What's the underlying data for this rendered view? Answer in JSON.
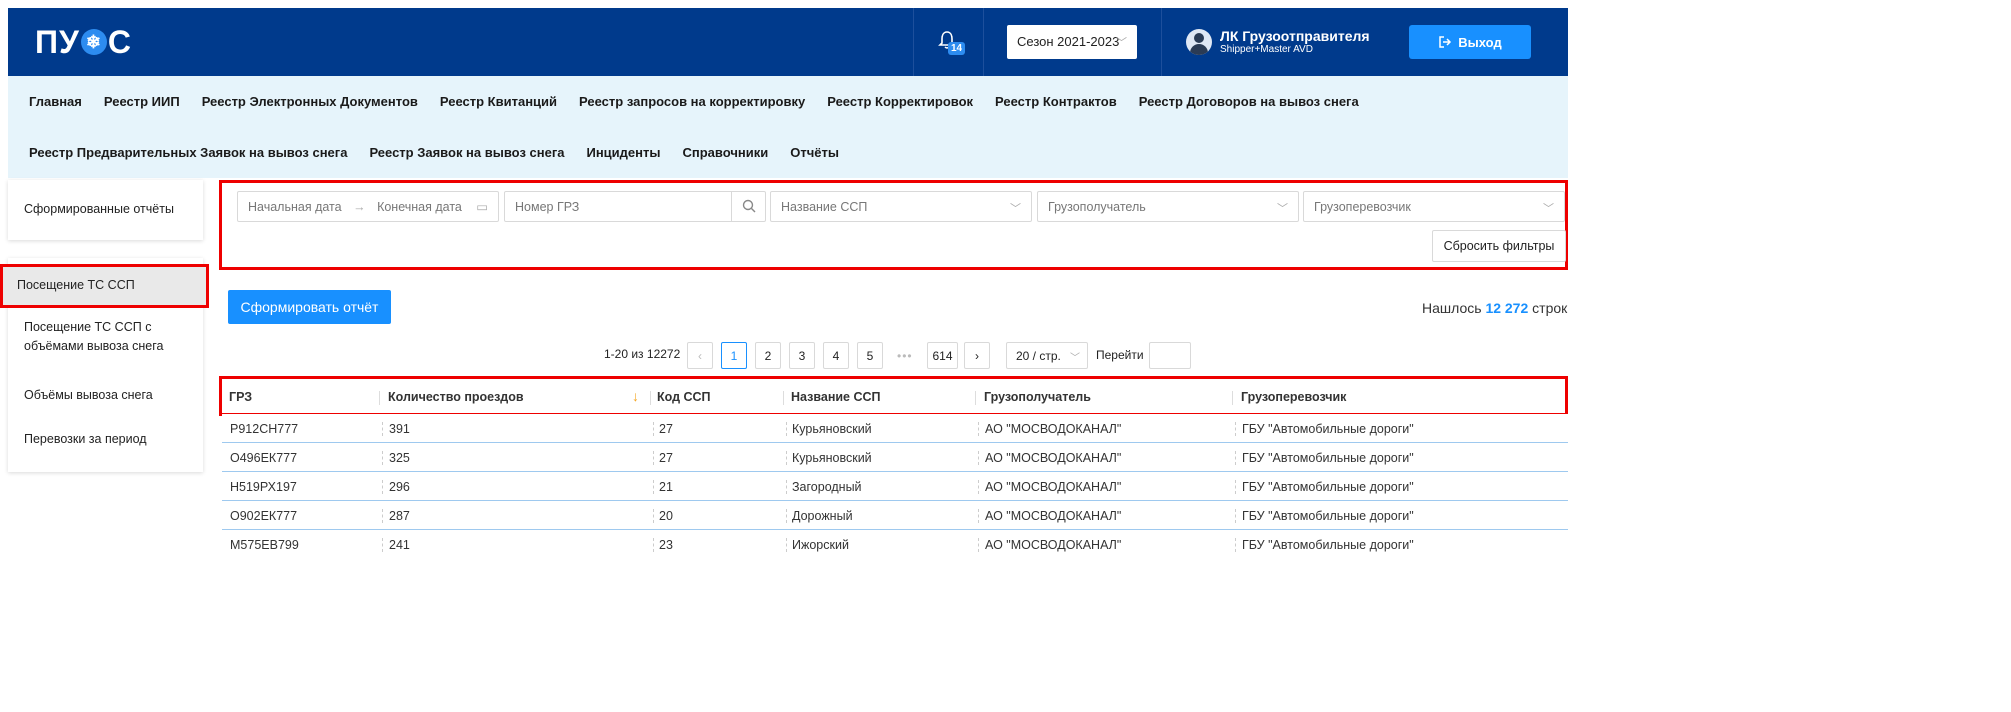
{
  "app": {
    "logo": "ПУ",
    "logo_end": "С"
  },
  "header": {
    "notifications_count": "14",
    "season": "Сезон 2021-2023",
    "user_title": "ЛК Грузоотправителя",
    "user_sub": "Shipper+Master AVD",
    "logout": "Выход"
  },
  "nav": {
    "row1": [
      "Главная",
      "Реестр ИИП",
      "Реестр Электронных Документов",
      "Реестр Квитанций",
      "Реестр запросов на корректировку",
      "Реестр Корректировок",
      "Реестр Контрактов",
      "Реестр Договоров на вывоз снега"
    ],
    "row2": [
      "Реестр Предварительных Заявок на вывоз снега",
      "Реестр Заявок на вывоз снега",
      "Инциденты",
      "Справочники",
      "Отчёты"
    ]
  },
  "sidebar": {
    "generated": "Сформированные отчёты",
    "items": [
      "Посещение ТС ССП",
      "Посещение ТС ССП с объёмами вывоза снега",
      "Объёмы вывоза снега",
      "Перевозки за период"
    ]
  },
  "filters": {
    "start_date": "Начальная дата",
    "end_date": "Конечная дата",
    "grz": "Номер ГРЗ",
    "ssp": "Название ССП",
    "consignee": "Грузополучатель",
    "carrier": "Грузоперевозчик",
    "reset": "Сбросить фильтры"
  },
  "actions": {
    "generate": "Сформировать отчёт"
  },
  "summary": {
    "found_prefix": "Нашлось",
    "found_count": "12 272",
    "found_suffix": "строк"
  },
  "pagination": {
    "range": "1-20 из 12272",
    "pages": [
      "1",
      "2",
      "3",
      "4",
      "5"
    ],
    "ellipsis": "•••",
    "last": "614",
    "page_size": "20 / стр.",
    "goto": "Перейти",
    "current": "1"
  },
  "table": {
    "columns": [
      "ГРЗ",
      "Количество проездов",
      "Код ССП",
      "Название ССП",
      "Грузополучатель",
      "Грузоперевозчик"
    ],
    "rows": [
      [
        "Р912СН777",
        "391",
        "27",
        "Курьяновский",
        "АО \"МОСВОДОКАНАЛ\"",
        "ГБУ \"Автомобильные дороги\""
      ],
      [
        "О496ЕК777",
        "325",
        "27",
        "Курьяновский",
        "АО \"МОСВОДОКАНАЛ\"",
        "ГБУ \"Автомобильные дороги\""
      ],
      [
        "Н519РХ197",
        "296",
        "21",
        "Загородный",
        "АО \"МОСВОДОКАНАЛ\"",
        "ГБУ \"Автомобильные дороги\""
      ],
      [
        "О902ЕК777",
        "287",
        "20",
        "Дорожный",
        "АО \"МОСВОДОКАНАЛ\"",
        "ГБУ \"Автомобильные дороги\""
      ],
      [
        "М575ЕВ799",
        "241",
        "23",
        "Ижорский",
        "АО \"МОСВОДОКАНАЛ\"",
        "ГБУ \"Автомобильные дороги\""
      ]
    ]
  },
  "colors": {
    "header_bg": "#003a8c",
    "accent": "#1890ff",
    "nav_bg": "#e6f4fb",
    "highlight": "#ee0000",
    "sort_arrow": "#f5a623"
  }
}
